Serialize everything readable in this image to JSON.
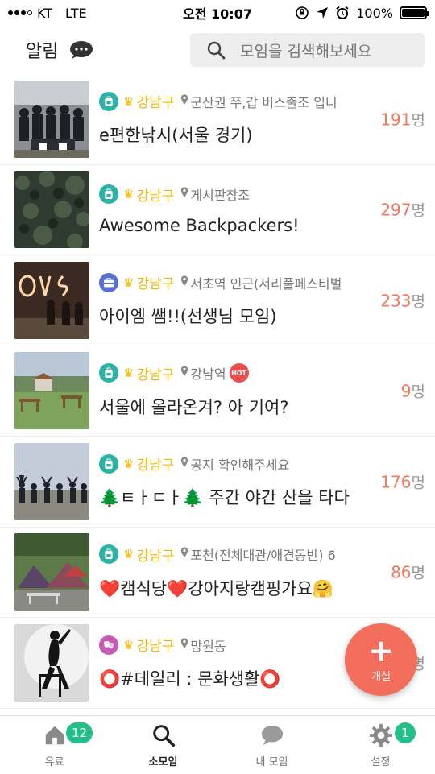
{
  "status_bar": {
    "carrier": "KT",
    "network": "LTE",
    "time": "오전 10:07",
    "battery": "100%",
    "battery_level": 1.0
  },
  "header": {
    "title": "알림",
    "search_placeholder": "모임을 검색해보세요"
  },
  "colors": {
    "accent": "#f26d5b",
    "region": "#f2b705",
    "count": "#f07a5e",
    "badge": "#22c088"
  },
  "groups": [
    {
      "category_icon": "backpack-icon",
      "category_color": "#2bb3a3",
      "region": "강남구",
      "location": "군산권 쭈,갑 버스출조 입니",
      "hot": "",
      "title": "e편한낚시(서울 경기)",
      "count": "191",
      "unit": "명"
    },
    {
      "category_icon": "backpack-icon",
      "category_color": "#2bb3a3",
      "region": "강남구",
      "location": "게시판참조",
      "hot": "",
      "title": "Awesome Backpackers!",
      "count": "297",
      "unit": "명"
    },
    {
      "category_icon": "briefcase-icon",
      "category_color": "#5a6fd6",
      "region": "강남구",
      "location": "서초역 인근(서리풀페스티벌",
      "hot": "",
      "title": "아이엠 쌤!!(선생님 모임)",
      "count": "233",
      "unit": "명"
    },
    {
      "category_icon": "backpack-icon",
      "category_color": "#2bb3a3",
      "region": "강남구",
      "location": "강남역",
      "hot": "HOT",
      "title": "서울에 올라온겨? 아 기여?",
      "count": "9",
      "unit": "명"
    },
    {
      "category_icon": "backpack-icon",
      "category_color": "#2bb3a3",
      "region": "강남구",
      "location": "공지 확인해주세요",
      "hot": "",
      "title": "🌲ㅌㅏㄷㅏ🌲 주간 야간 산을 타다",
      "count": "176",
      "unit": "명"
    },
    {
      "category_icon": "backpack-icon",
      "category_color": "#2bb3a3",
      "region": "강남구",
      "location": "포천(전체대관/애견동반) 6",
      "hot": "",
      "title": "❤️캠식당❤️강아지랑캠핑가요🤗",
      "count": "86",
      "unit": "명"
    },
    {
      "category_icon": "theater-masks-icon",
      "category_color": "#c65bb5",
      "region": "강남구",
      "location": "망원동",
      "hot": "",
      "title": "⭕#데일리 : 문화생활⭕",
      "count": "",
      "unit": "명"
    }
  ],
  "fab": {
    "plus": "+",
    "label": "개설"
  },
  "tabs": [
    {
      "label": "유료",
      "icon": "home-icon",
      "badge": "12",
      "active": false
    },
    {
      "label": "소모임",
      "icon": "search-icon",
      "badge": "",
      "active": true
    },
    {
      "label": "내 모임",
      "icon": "chat-bubble-icon",
      "badge": "",
      "active": false
    },
    {
      "label": "설정",
      "icon": "gear-icon",
      "badge": "1",
      "active": false
    }
  ]
}
